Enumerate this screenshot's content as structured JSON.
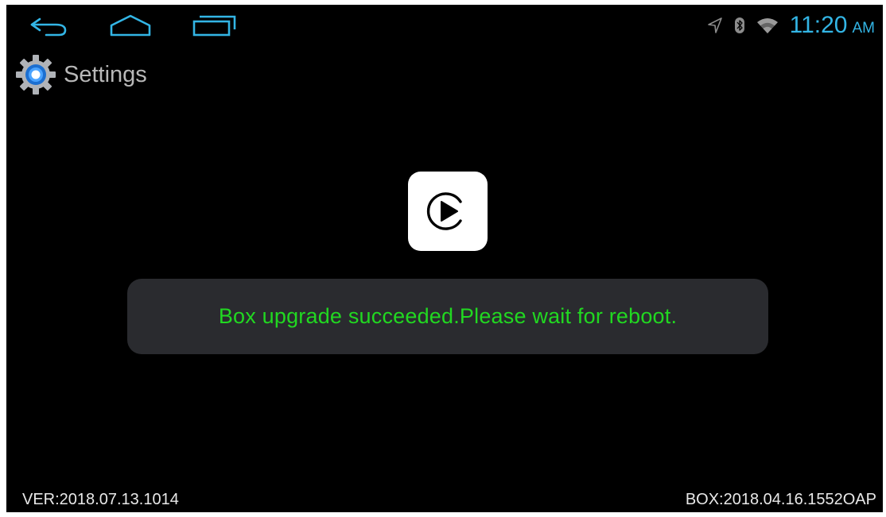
{
  "status_bar": {
    "time": "11:20",
    "ampm": "AM",
    "icons": [
      "location-icon",
      "bluetooth-icon",
      "wifi-icon"
    ],
    "accent_color": "#33b5e5"
  },
  "nav_bar": {
    "buttons": [
      "back-icon",
      "home-icon",
      "recent-apps-icon"
    ],
    "icon_color": "#33b5e5"
  },
  "settings": {
    "label": "Settings",
    "icon": "gear-icon"
  },
  "app_icon": {
    "name": "carplay-icon"
  },
  "toast": {
    "message": "Box upgrade succeeded.Please wait for reboot.",
    "text_color": "#21d821",
    "background": "#2a2b2f"
  },
  "footer": {
    "ver": "VER:2018.07.13.1014",
    "box": "BOX:2018.04.16.1552OAP"
  }
}
